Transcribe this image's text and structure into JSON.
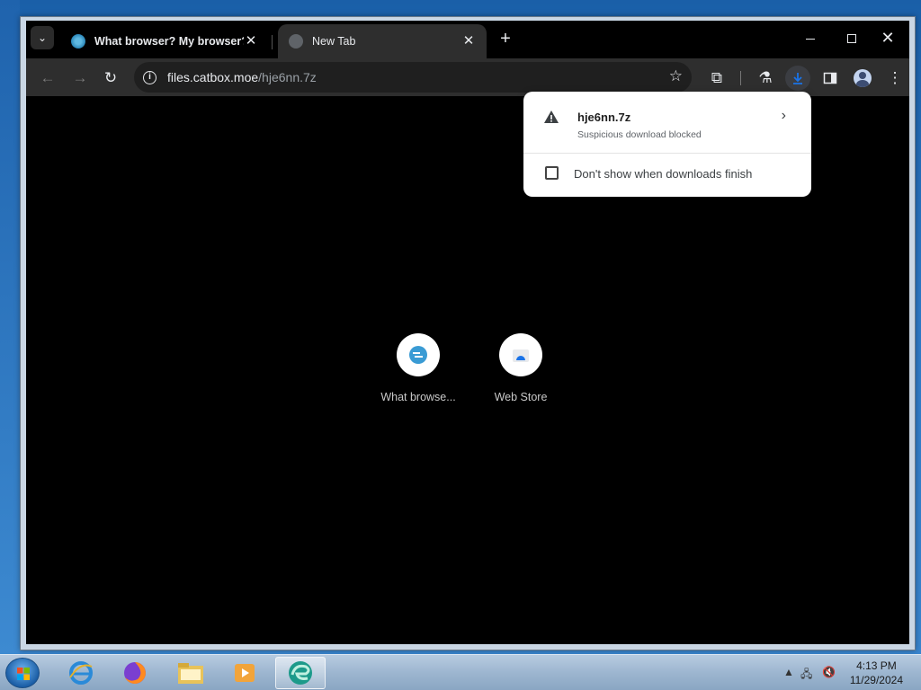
{
  "browser": {
    "tabs": [
      {
        "label": "What browser? My browser? Is",
        "active": false
      },
      {
        "label": "New Tab",
        "active": true
      }
    ],
    "omnibox": {
      "host": "files.catbox.moe",
      "path": "/hje6nn.7z"
    }
  },
  "downloads_bubble": {
    "filename": "hje6nn.7z",
    "status": "Suspicious download blocked",
    "checkbox_label": "Don't show when downloads finish",
    "checkbox_checked": false
  },
  "new_tab": {
    "shortcuts": [
      {
        "label": "What browse..."
      },
      {
        "label": "Web Store"
      }
    ]
  },
  "taskbar": {
    "clock_time": "4:13 PM",
    "clock_date": "11/29/2024"
  },
  "colors": {
    "toolbar": "#2e2e2e",
    "accent_blue": "#1a73e8"
  }
}
